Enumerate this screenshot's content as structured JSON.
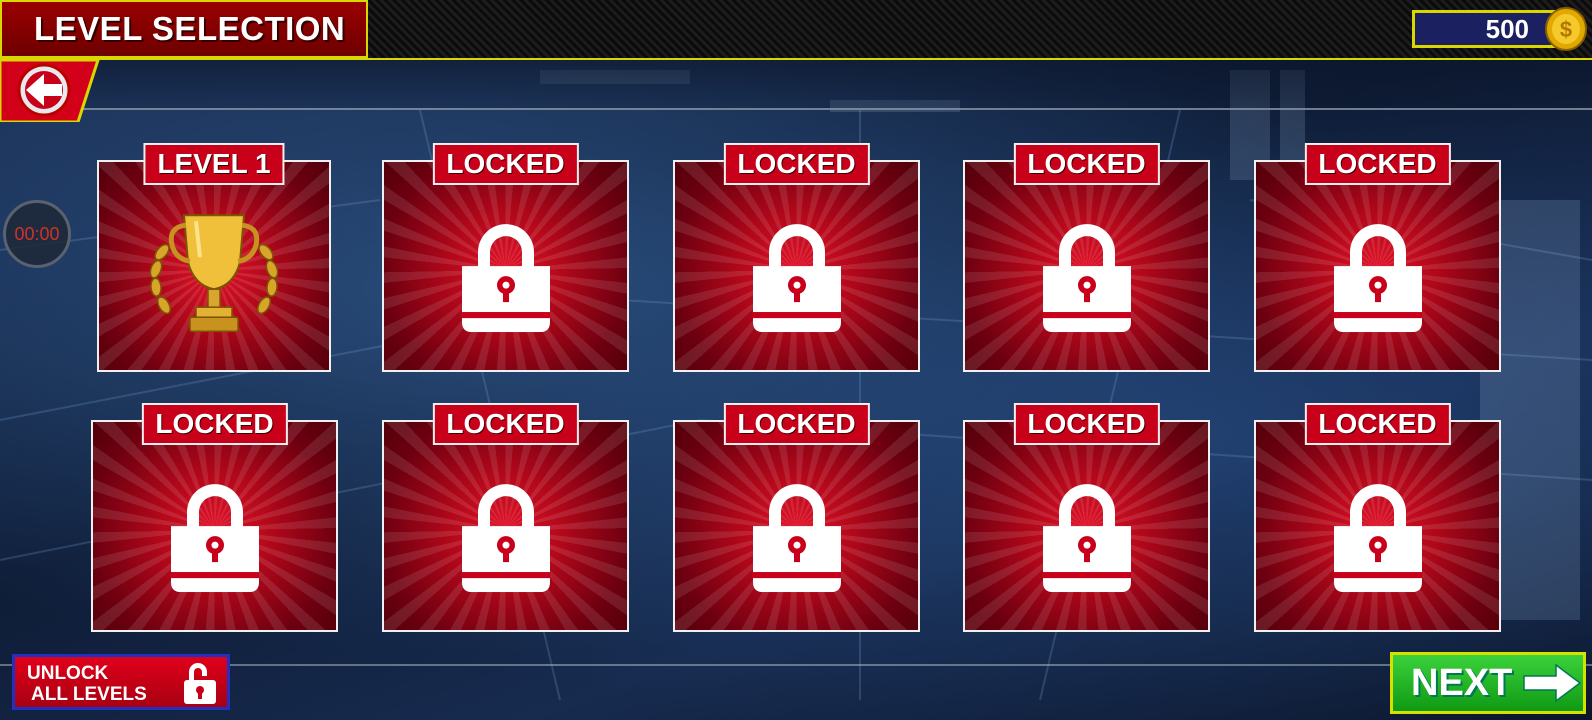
{
  "header": {
    "title": "LEVEL SELECTION",
    "coins": "500"
  },
  "timer": {
    "value": "00:00"
  },
  "levels": [
    {
      "label": "LEVEL 1",
      "icon": "trophy-icon",
      "locked": false
    },
    {
      "label": "LOCKED",
      "icon": "padlock-icon",
      "locked": true
    },
    {
      "label": "LOCKED",
      "icon": "padlock-icon",
      "locked": true
    },
    {
      "label": "LOCKED",
      "icon": "padlock-icon",
      "locked": true
    },
    {
      "label": "LOCKED",
      "icon": "padlock-icon",
      "locked": true
    },
    {
      "label": "LOCKED",
      "icon": "padlock-icon",
      "locked": true
    },
    {
      "label": "LOCKED",
      "icon": "padlock-icon",
      "locked": true
    },
    {
      "label": "LOCKED",
      "icon": "padlock-icon",
      "locked": true
    },
    {
      "label": "LOCKED",
      "icon": "padlock-icon",
      "locked": true
    },
    {
      "label": "LOCKED",
      "icon": "padlock-icon",
      "locked": true
    }
  ],
  "footer": {
    "unlock_line1": "UNLOCK",
    "unlock_line2": "ALL LEVELS",
    "next_label": "NEXT"
  },
  "colors": {
    "accent_yellow": "#d8d800",
    "card_red": "#b1081a",
    "next_green": "#1fb825",
    "panel_navy": "#1a2060"
  }
}
